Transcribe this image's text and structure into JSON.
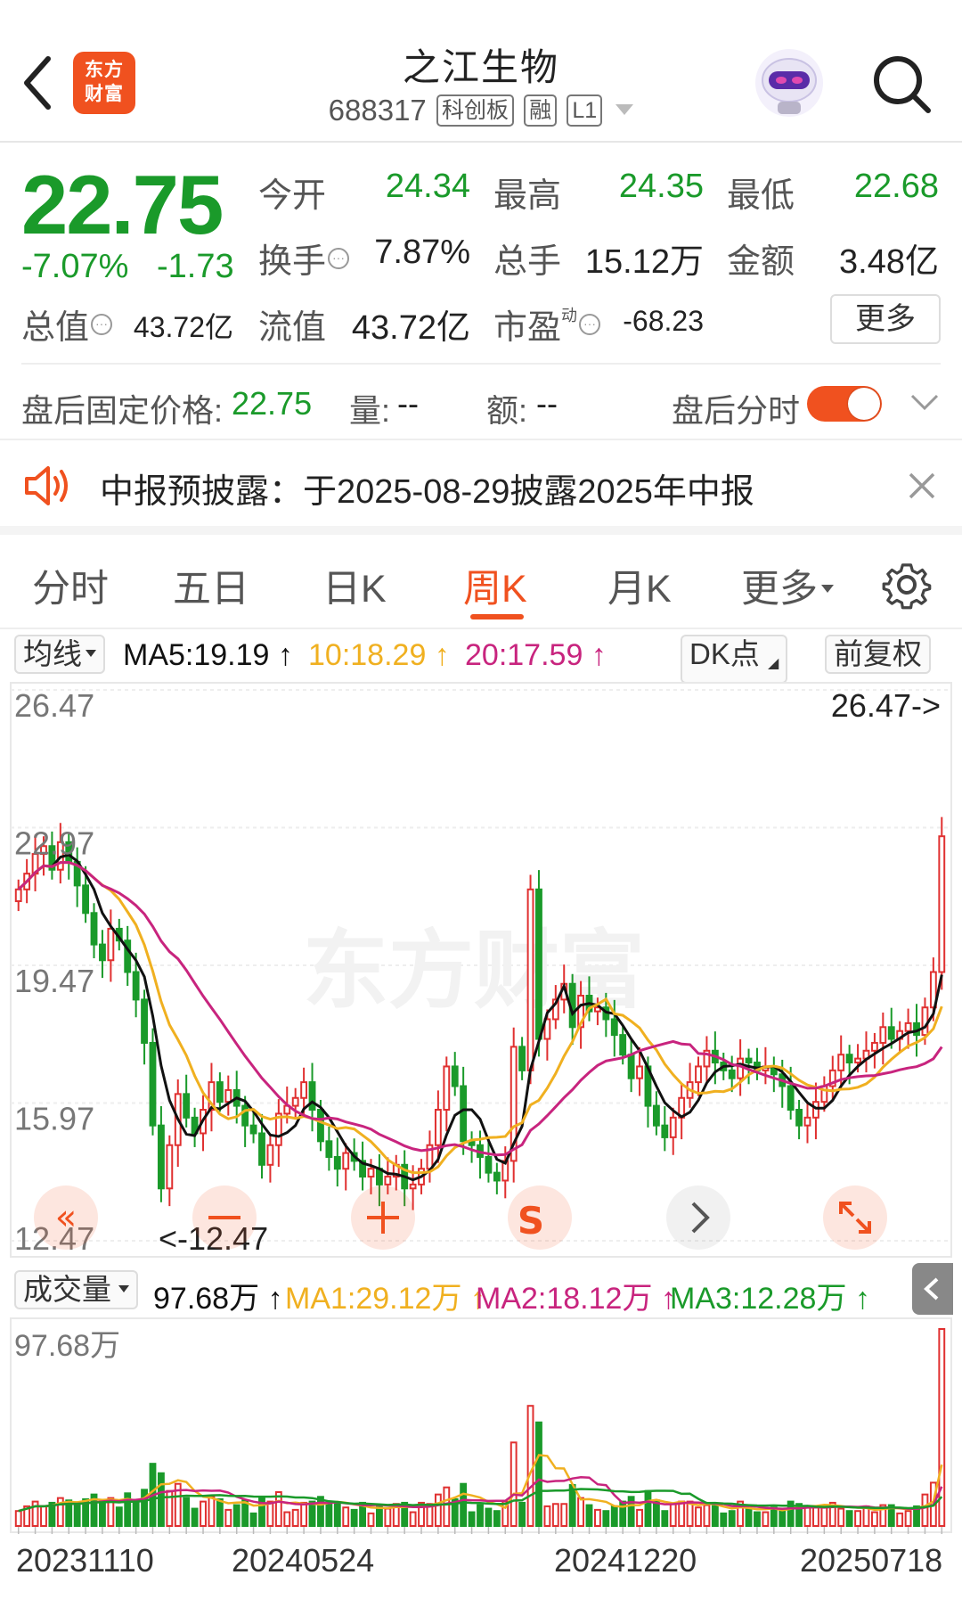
{
  "header": {
    "logo_line1": "东方",
    "logo_line2": "财富",
    "stock_name": "之江生物",
    "stock_code": "688317",
    "tags": [
      "科创板",
      "融",
      "L1"
    ]
  },
  "quote": {
    "price": "22.75",
    "change_pct": "-7.07%",
    "change_amt": "-1.73",
    "open_label": "今开",
    "open_value": "24.34",
    "high_label": "最高",
    "high_value": "24.35",
    "low_label": "最低",
    "low_value": "22.68",
    "turnover_label": "换手",
    "turnover_value": "7.87%",
    "volume_label": "总手",
    "volume_value": "15.12万",
    "amount_label": "金额",
    "amount_value": "3.48亿",
    "mktcap_label": "总值",
    "mktcap_value": "43.72亿",
    "float_label": "流值",
    "float_value": "43.72亿",
    "pe_label": "市盈",
    "pe_super": "动",
    "pe_value": "-68.23",
    "more_label": "更多"
  },
  "after_hours": {
    "price_label": "盘后固定价格:",
    "price_value": "22.75",
    "vol_label": "量:",
    "vol_value": "--",
    "amt_label": "额:",
    "amt_value": "--",
    "toggle_label": "盘后分时"
  },
  "announcement": {
    "text": "中报预披露：于2025-08-29披露2025年中报"
  },
  "tabs": [
    {
      "label": "分时"
    },
    {
      "label": "五日"
    },
    {
      "label": "日K"
    },
    {
      "label": "周K"
    },
    {
      "label": "月K"
    },
    {
      "label": "更多"
    }
  ],
  "ma_bar": {
    "selector": "均线",
    "ma5": "MA5:19.19",
    "ma10": "10:18.29",
    "ma20": "20:17.59",
    "dk_label": "DK点",
    "adjust_label": "前复权"
  },
  "kline_axis": {
    "labels": [
      "26.47",
      "22.97",
      "19.47",
      "15.97",
      "12.47"
    ],
    "max_marker": "26.47->",
    "min_marker": "<-12.47"
  },
  "volume_bar": {
    "selector": "成交量",
    "vol": "97.68万",
    "ma1": "MA1:29.12万",
    "ma2": "MA2:18.12万",
    "ma3": "MA3:12.28万",
    "axis_max": "97.68万"
  },
  "dates": [
    "20231110",
    "20240524",
    "20241220",
    "20250718"
  ],
  "colors": {
    "up": "#e03030",
    "down": "#1a9a2a",
    "accent": "#f0511f",
    "ma5": "#111111",
    "ma10": "#f0b020",
    "ma20": "#c8247e"
  },
  "chart_data": {
    "type": "candlestick",
    "ylim": [
      12.47,
      26.47
    ],
    "closes": [
      21.4,
      21.8,
      22.3,
      22.5,
      21.9,
      22.6,
      22.1,
      21.5,
      20.8,
      20.0,
      19.6,
      20.4,
      20.1,
      19.3,
      18.6,
      17.5,
      15.4,
      13.8,
      14.9,
      16.2,
      15.6,
      15.2,
      15.8,
      16.5,
      16.0,
      16.3,
      15.9,
      15.4,
      15.2,
      14.4,
      14.9,
      15.7,
      15.9,
      16.1,
      16.5,
      15.8,
      15.0,
      14.6,
      14.3,
      14.7,
      14.5,
      14.1,
      14.3,
      13.9,
      14.1,
      14.4,
      13.8,
      13.9,
      14.3,
      14.9,
      15.8,
      16.9,
      16.4,
      15.0,
      14.9,
      14.6,
      14.2,
      14.0,
      14.5,
      17.4,
      16.8,
      21.4,
      17.6,
      18.1,
      18.6,
      19.0,
      17.9,
      18.7,
      18.3,
      18.4,
      18.1,
      17.7,
      17.2,
      16.6,
      16.9,
      15.9,
      15.4,
      15.1,
      15.6,
      16.1,
      16.5,
      16.9,
      17.3,
      17.0,
      16.8,
      16.6,
      17.1,
      17.0,
      16.8,
      16.9,
      16.7,
      16.4,
      15.8,
      15.4,
      15.6,
      16.0,
      16.4,
      16.8,
      17.2,
      17.0,
      17.1,
      17.3,
      17.5,
      17.9,
      17.6,
      17.8,
      18.0,
      17.7,
      18.4,
      19.3,
      22.75
    ]
  }
}
